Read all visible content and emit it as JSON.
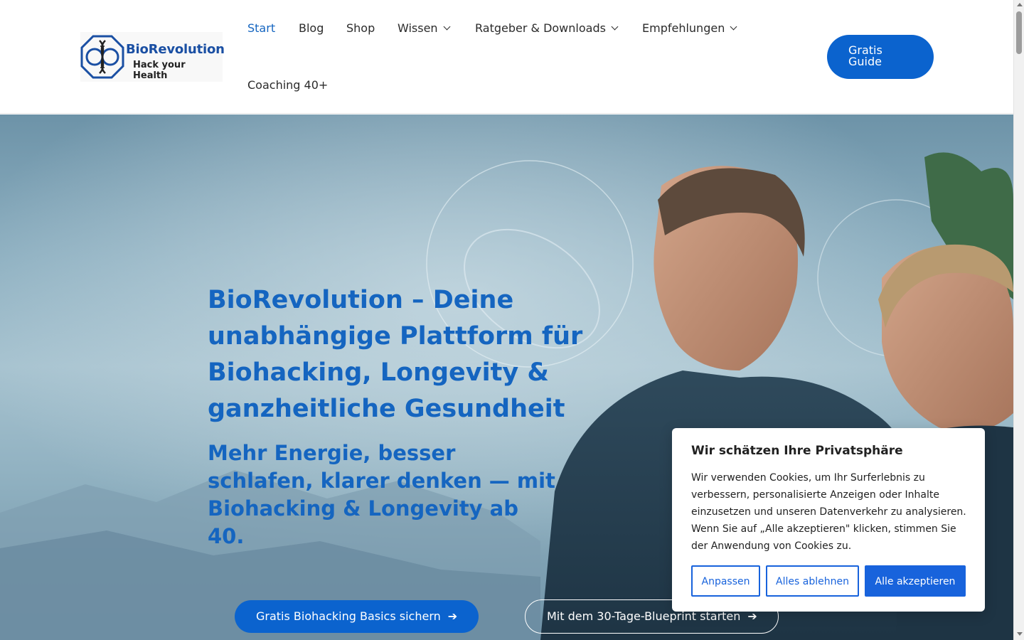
{
  "header": {
    "logo": {
      "name": "BioRevolution",
      "tagline": "Hack your Health"
    },
    "nav": [
      {
        "label": "Start"
      },
      {
        "label": "Blog"
      },
      {
        "label": "Shop"
      },
      {
        "label": "Wissen"
      },
      {
        "label": "Ratgeber & Downloads"
      },
      {
        "label": "Empfehlungen"
      },
      {
        "label": "Coaching 40+"
      }
    ],
    "cta_line1": "Gratis",
    "cta_line2": "Guide"
  },
  "hero": {
    "title": "BioRevolution – Deine unabhängige Plattform für Biohacking, Longevity & ganzheitliche Gesundheit",
    "subtitle": "Mehr Energie, besser schlafen, klarer denken — mit Biohacking & Longevity ab 40.",
    "primary_button": "Gratis Biohacking Basics sichern",
    "secondary_button": "Mit dem 30-Tage-Blueprint starten"
  },
  "cookie": {
    "title": "Wir schätzen Ihre Privatsphäre",
    "text": "Wir verwenden Cookies, um Ihr Surferlebnis zu verbessern, personalisierte Anzeigen oder Inhalte einzusetzen und unseren Datenverkehr zu analysieren. Wenn Sie auf „Alle akzeptieren\" klicken, stimmen Sie der Anwendung von Cookies zu.",
    "customize": "Anpassen",
    "reject": "Alles ablehnen",
    "accept": "Alle akzeptieren"
  },
  "colors": {
    "accent": "#0b63ce",
    "heading": "#1565c0",
    "cookie_accent": "#1863dc"
  },
  "icons": {
    "dropdown": "chevron-down-icon",
    "arrow": "arrow-right-icon"
  }
}
